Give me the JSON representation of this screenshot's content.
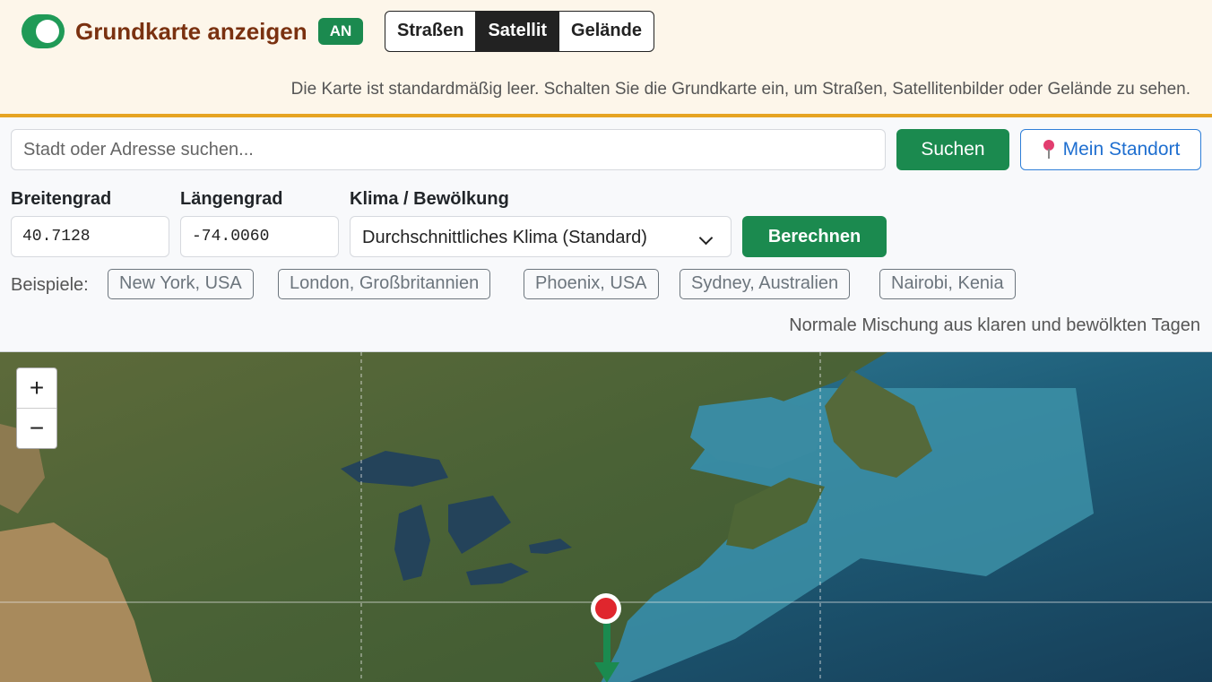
{
  "basemap": {
    "toggle_on": true,
    "title": "Grundkarte anzeigen",
    "badge": "AN",
    "options": [
      "Straßen",
      "Satellit",
      "Gelände"
    ],
    "active_option": "Satellit",
    "hint": "Die Karte ist standardmäßig leer. Schalten Sie die Grundkarte ein, um Straßen, Satellitenbilder oder Gelände zu sehen."
  },
  "search": {
    "placeholder": "Stadt oder Adresse suchen...",
    "value": "",
    "search_label": "Suchen",
    "locate_label": "Mein Standort",
    "locate_icon": "map-pin-icon"
  },
  "coords": {
    "lat_label": "Breitengrad",
    "lat_value": "40.7128",
    "lon_label": "Längengrad",
    "lon_value": "-74.0060",
    "climate_label": "Klima / Bewölkung",
    "climate_selected": "Durchschnittliches Klima (Standard)",
    "calc_label": "Berechnen"
  },
  "examples": {
    "label": "Beispiele:",
    "items": [
      "New York, USA",
      "London, Großbritannien",
      "Phoenix, USA",
      "Sydney, Australien",
      "Nairobi, Kenia"
    ]
  },
  "climate_description": "Normale Mischung aus klaren und bewölkten Tagen",
  "map": {
    "zoom_in": "+",
    "zoom_out": "−",
    "marker_color": "#e0262d",
    "arrow_color": "#1b8a4f"
  },
  "colors": {
    "accent_green": "#1b8a4f",
    "banner_bg": "#fdf6ea",
    "banner_border": "#e6a422",
    "title_brown": "#7a3110",
    "link_blue": "#1f6fd0"
  }
}
